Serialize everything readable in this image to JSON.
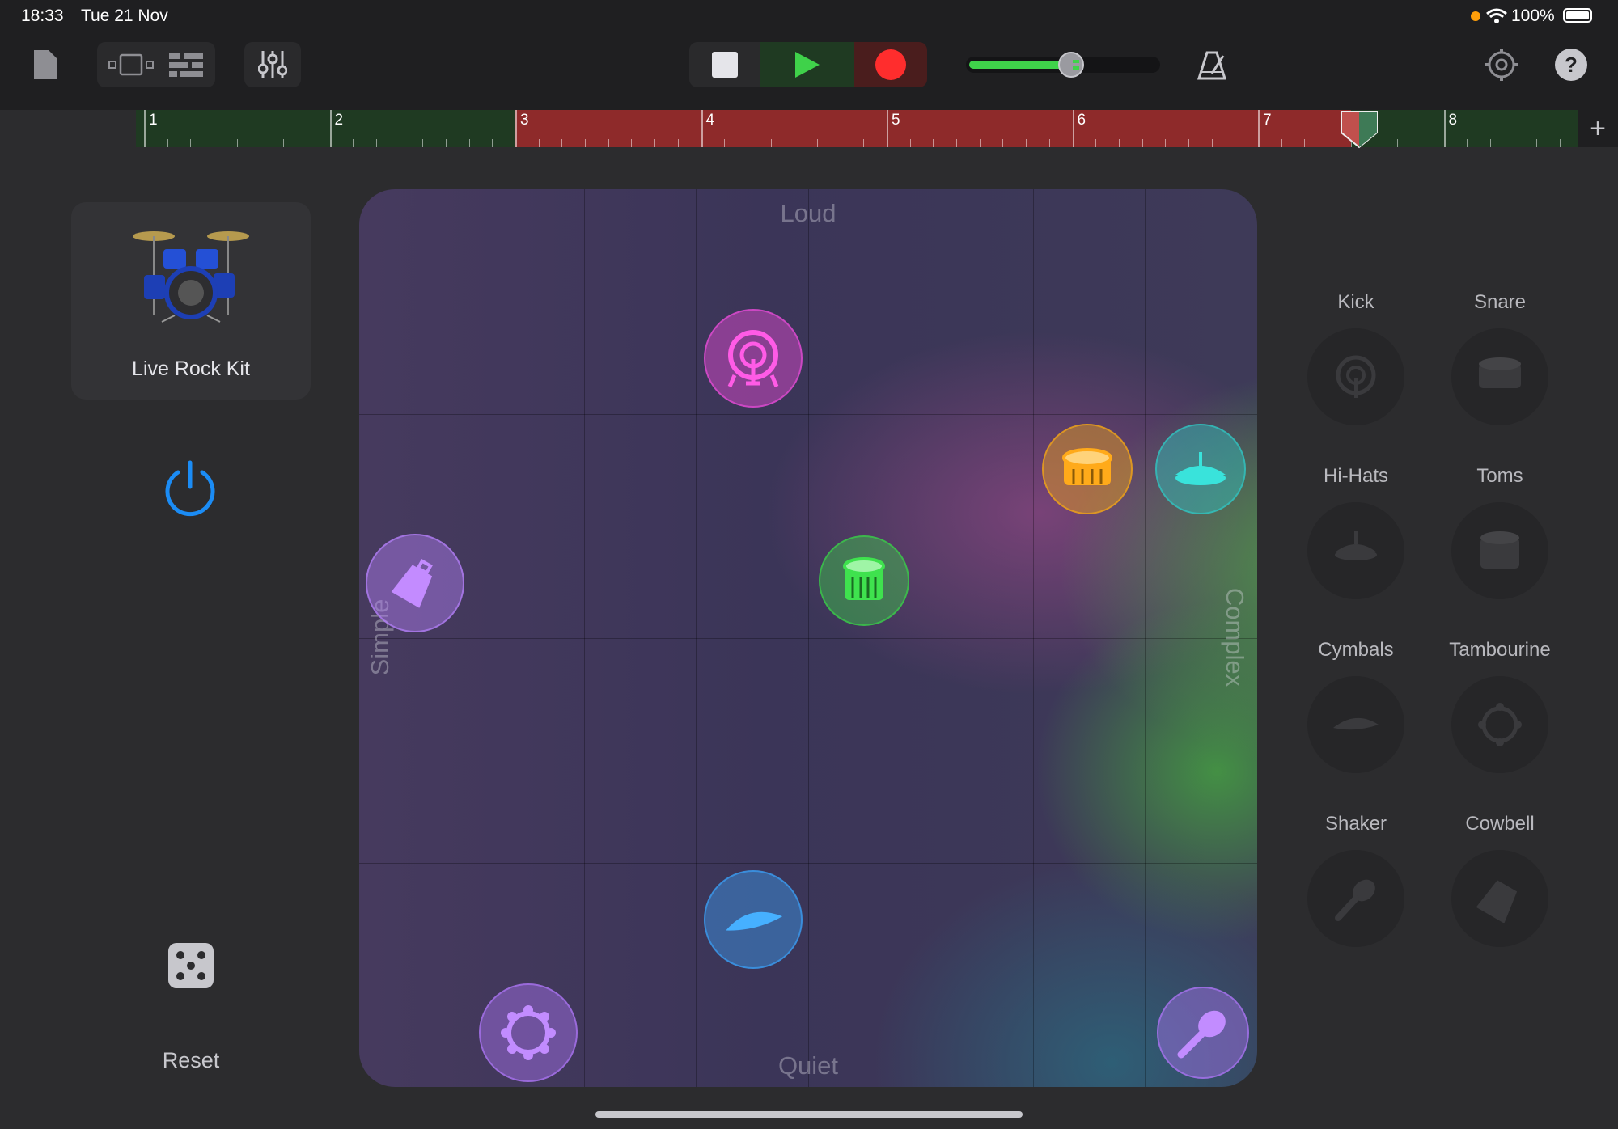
{
  "status": {
    "time": "18:33",
    "date": "Tue 21 Nov",
    "battery": "100%"
  },
  "toolbar": {
    "accent_green": "#3fd24a",
    "accent_red": "#ff2d2d",
    "volume_level": 0.55
  },
  "ruler": {
    "bars": [
      "1",
      "2",
      "3",
      "4",
      "5",
      "6",
      "7",
      "8"
    ],
    "cycle_from_bar": 3,
    "cycle_to_bar": 7.5
  },
  "kit": {
    "name": "Live Rock Kit"
  },
  "controls": {
    "reset_label": "Reset"
  },
  "pad": {
    "label_top": "Loud",
    "label_bottom": "Quiet",
    "label_left": "Simple",
    "label_right": "Complex",
    "pucks": [
      {
        "name": "kick-puck",
        "icon": "kick-drum-icon",
        "color": "#e84bd8"
      },
      {
        "name": "snare-puck",
        "icon": "snare-drum-icon",
        "color": "#f0a418"
      },
      {
        "name": "hihat-puck",
        "icon": "hi-hat-icon",
        "color": "#31c4c0"
      },
      {
        "name": "cowbell-puck",
        "icon": "cowbell-icon",
        "color": "#b27ef5"
      },
      {
        "name": "toms-puck",
        "icon": "tom-drum-icon",
        "color": "#3bcb4a"
      },
      {
        "name": "cymbals-puck",
        "icon": "cymbal-icon",
        "color": "#3b9cf0"
      },
      {
        "name": "tambourine-puck",
        "icon": "tambourine-icon",
        "color": "#a873f0"
      },
      {
        "name": "shaker-puck",
        "icon": "shaker-icon",
        "color": "#a873f0"
      }
    ]
  },
  "instruments": [
    {
      "label": "Kick",
      "icon": "kick-drum-icon"
    },
    {
      "label": "Snare",
      "icon": "snare-drum-icon"
    },
    {
      "label": "Hi-Hats",
      "icon": "hi-hat-icon"
    },
    {
      "label": "Toms",
      "icon": "tom-drum-icon"
    },
    {
      "label": "Cymbals",
      "icon": "cymbal-icon"
    },
    {
      "label": "Tambourine",
      "icon": "tambourine-icon"
    },
    {
      "label": "Shaker",
      "icon": "shaker-icon"
    },
    {
      "label": "Cowbell",
      "icon": "cowbell-icon"
    }
  ]
}
